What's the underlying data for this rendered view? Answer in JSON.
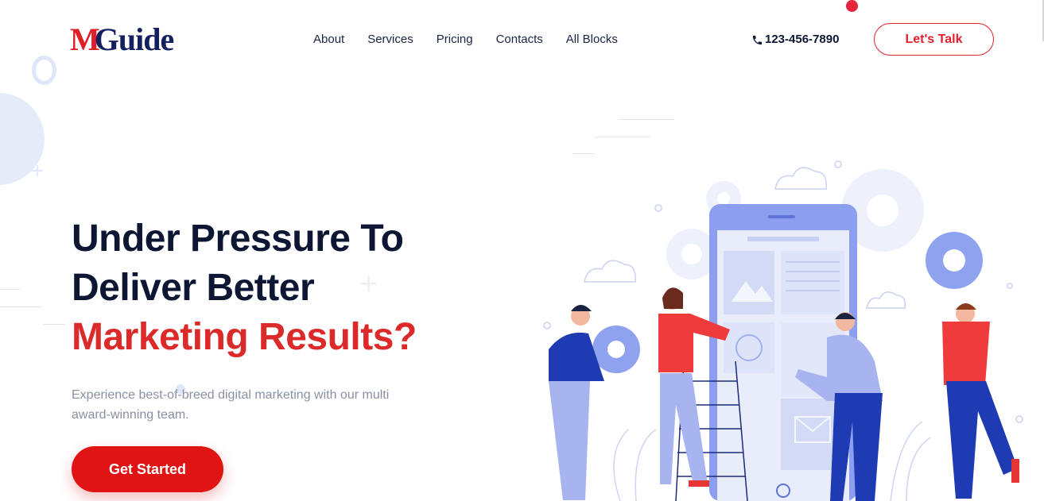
{
  "brand": {
    "logo_m": "M",
    "logo_rest": "Guide"
  },
  "nav": {
    "items": [
      {
        "label": "About"
      },
      {
        "label": "Services"
      },
      {
        "label": "Pricing"
      },
      {
        "label": "Contacts"
      },
      {
        "label": "All Blocks"
      }
    ]
  },
  "header": {
    "phone": "123-456-7890",
    "phone_icon": "phone-icon",
    "talk_label": "Let's Talk"
  },
  "hero": {
    "line1": "Under Pressure To",
    "line2": "Deliver Better",
    "line3": "Marketing Results?",
    "subtitle": "Experience best-of-breed digital marketing with our multi award-winning team.",
    "cta_label": "Get Started"
  },
  "colors": {
    "accent_red": "#e01414",
    "brand_navy": "#15205f",
    "illustration_blue": "#7f96ee"
  }
}
